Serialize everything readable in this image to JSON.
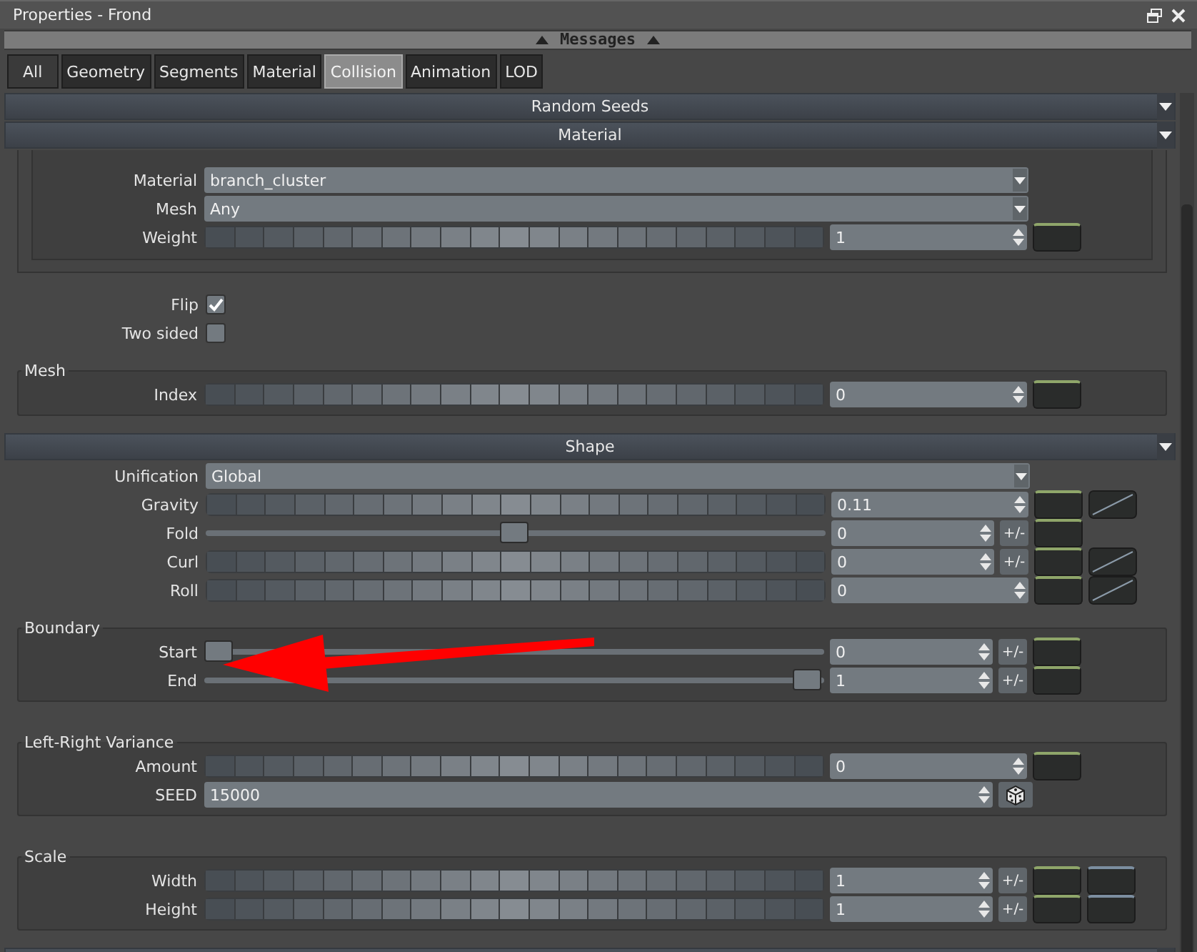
{
  "window": {
    "title": "Properties - Frond"
  },
  "messages_bar": {
    "label": "Messages"
  },
  "tabs": [
    {
      "label": "All",
      "selected": false
    },
    {
      "label": "Geometry",
      "selected": false
    },
    {
      "label": "Segments",
      "selected": false
    },
    {
      "label": "Material",
      "selected": false
    },
    {
      "label": "Collision",
      "selected": true
    },
    {
      "label": "Animation",
      "selected": false
    },
    {
      "label": "LOD",
      "selected": false
    }
  ],
  "panel": [
    {
      "kind": "header",
      "title": "Random Seeds"
    },
    {
      "kind": "header",
      "title": "Material"
    },
    {
      "kind": "subgroup",
      "rows": [
        {
          "kind": "dropdown",
          "label": "Material",
          "value": "branch_cluster"
        },
        {
          "kind": "dropdown",
          "label": "Mesh",
          "value": "Any"
        },
        {
          "kind": "segmented",
          "label": "Weight",
          "value": "1",
          "pm": false,
          "graph": false,
          "second_swatch": false
        }
      ]
    },
    {
      "kind": "row",
      "row": {
        "kind": "checkbox",
        "label": "Flip",
        "checked": true
      }
    },
    {
      "kind": "row",
      "row": {
        "kind": "checkbox",
        "label": "Two sided",
        "checked": false
      }
    },
    {
      "kind": "group",
      "title": "Mesh",
      "rows": [
        {
          "kind": "segmented",
          "label": "Index",
          "value": "0",
          "pm": false,
          "graph": false,
          "second_swatch": false
        }
      ]
    },
    {
      "kind": "header",
      "title": "Shape"
    },
    {
      "kind": "row",
      "row": {
        "kind": "dropdown",
        "label": "Unification",
        "value": "Global"
      }
    },
    {
      "kind": "row",
      "row": {
        "kind": "segmented",
        "label": "Gravity",
        "value": "0.11",
        "pm": false,
        "graph": true,
        "second_swatch": false
      }
    },
    {
      "kind": "row",
      "row": {
        "kind": "thumb",
        "label": "Fold",
        "level": 0.5,
        "value": "0",
        "pm": true,
        "graph": false,
        "second_swatch": false
      }
    },
    {
      "kind": "row",
      "row": {
        "kind": "segmented",
        "label": "Curl",
        "value": "0",
        "pm": true,
        "graph": true,
        "second_swatch": false
      }
    },
    {
      "kind": "row",
      "row": {
        "kind": "segmented",
        "label": "Roll",
        "value": "0",
        "pm": false,
        "graph": true,
        "second_swatch": false
      }
    },
    {
      "kind": "group",
      "title": "Boundary",
      "rows": [
        {
          "kind": "thumb",
          "label": "Start",
          "level": 0,
          "value": "0",
          "pm": true,
          "graph": false,
          "second_swatch": false
        },
        {
          "kind": "thumb",
          "label": "End",
          "level": 1,
          "value": "1",
          "pm": true,
          "graph": false,
          "second_swatch": false
        }
      ]
    },
    {
      "kind": "group",
      "title": "Left-Right Variance",
      "rows": [
        {
          "kind": "segmented",
          "label": "Amount",
          "value": "0",
          "pm": false,
          "graph": false,
          "second_swatch": false
        },
        {
          "kind": "seed",
          "label": "SEED",
          "value": "15000"
        }
      ]
    },
    {
      "kind": "group",
      "title": "Scale",
      "rows": [
        {
          "kind": "segmented",
          "label": "Width",
          "value": "1",
          "pm": true,
          "graph": false,
          "second_swatch": true
        },
        {
          "kind": "segmented",
          "label": "Height",
          "value": "1",
          "pm": true,
          "graph": false,
          "second_swatch": true
        }
      ]
    },
    {
      "kind": "header"
    }
  ],
  "pm_label": "+/-"
}
